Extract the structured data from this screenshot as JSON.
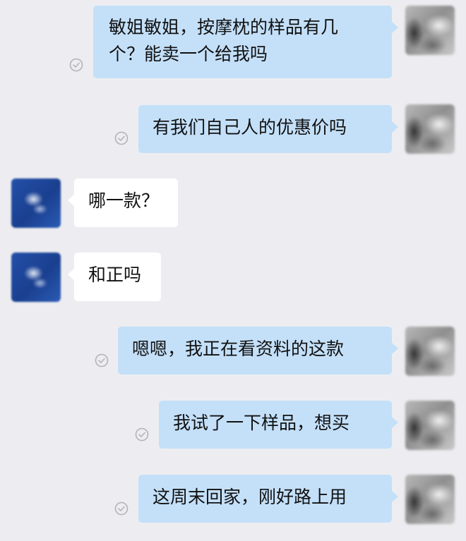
{
  "messages": [
    {
      "direction": "out",
      "lines": [
        "敏姐敏姐，按摩枕的样品有几",
        "个？能卖一个给我吗"
      ],
      "status_icon": "read-check-icon"
    },
    {
      "direction": "out",
      "lines": [
        "有我们自己人的优惠价吗"
      ],
      "status_icon": "read-check-icon"
    },
    {
      "direction": "in",
      "lines": [
        "哪一款？"
      ]
    },
    {
      "direction": "in",
      "lines": [
        "和正吗"
      ]
    },
    {
      "direction": "out",
      "lines": [
        "嗯嗯，我正在看资料的这款"
      ],
      "status_icon": "read-check-icon"
    },
    {
      "direction": "out",
      "lines": [
        "我试了一下样品，想买"
      ],
      "status_icon": "read-check-icon"
    },
    {
      "direction": "out",
      "lines": [
        "这周末回家，刚好路上用"
      ],
      "status_icon": "read-check-icon"
    }
  ],
  "colors": {
    "background": "#ededf1",
    "outgoing_bubble": "#c4e0f9",
    "incoming_bubble": "#ffffff",
    "text": "#111111",
    "status_icon": "#b3b3b8"
  }
}
